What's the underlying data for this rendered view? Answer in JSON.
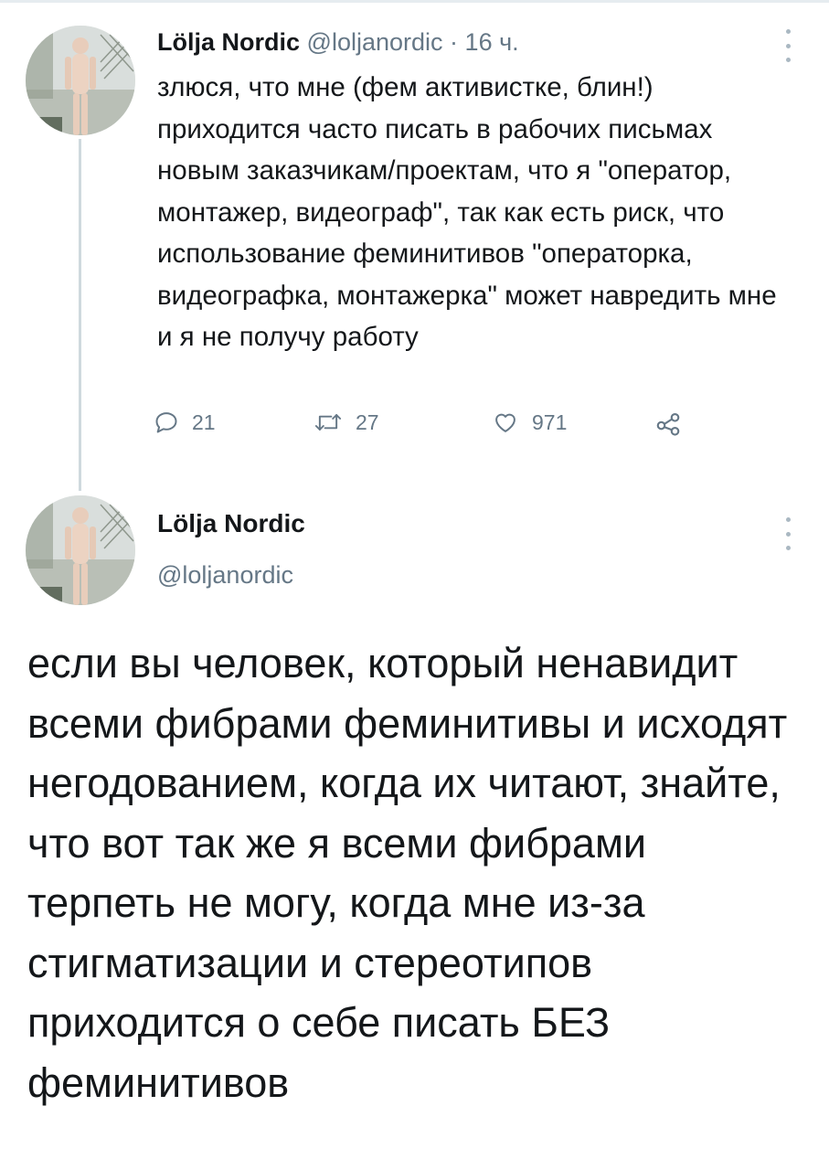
{
  "tweet1": {
    "author_name": "Lölja Nordic",
    "handle": "@loljanordic",
    "separator": "·",
    "time": "16 ч.",
    "text": "злюся, что мне (фем активистке, блин!) приходится часто писать в рабочих письмах новым заказчикам/проектам, что я \"оператор, монтажер, видеограф\", так как есть риск, что использование феминитивов \"операторка, видеографка, монтажерка\" может навредить мне и я не получу работу",
    "replies": "21",
    "retweets": "27",
    "likes": "971",
    "icons": {
      "reply": "reply-icon",
      "retweet": "retweet-icon",
      "like": "heart-icon",
      "share": "share-icon",
      "more": "more-vertical-icon"
    }
  },
  "tweet2": {
    "author_name": "Lölja Nordic",
    "handle": "@loljanordic",
    "text": "если вы человек, который ненавидит всеми фибрами феминитивы и исходят негодованием, когда их читают, знайте, что вот так же я всеми фибрами терпеть не могу, когда мне из-за стигматизации и стереотипов приходится о себе писать БЕЗ феминитивов"
  },
  "colors": {
    "text": "#14171a",
    "muted": "#657786",
    "thread_line": "#cfd9de",
    "background": "#ffffff"
  }
}
